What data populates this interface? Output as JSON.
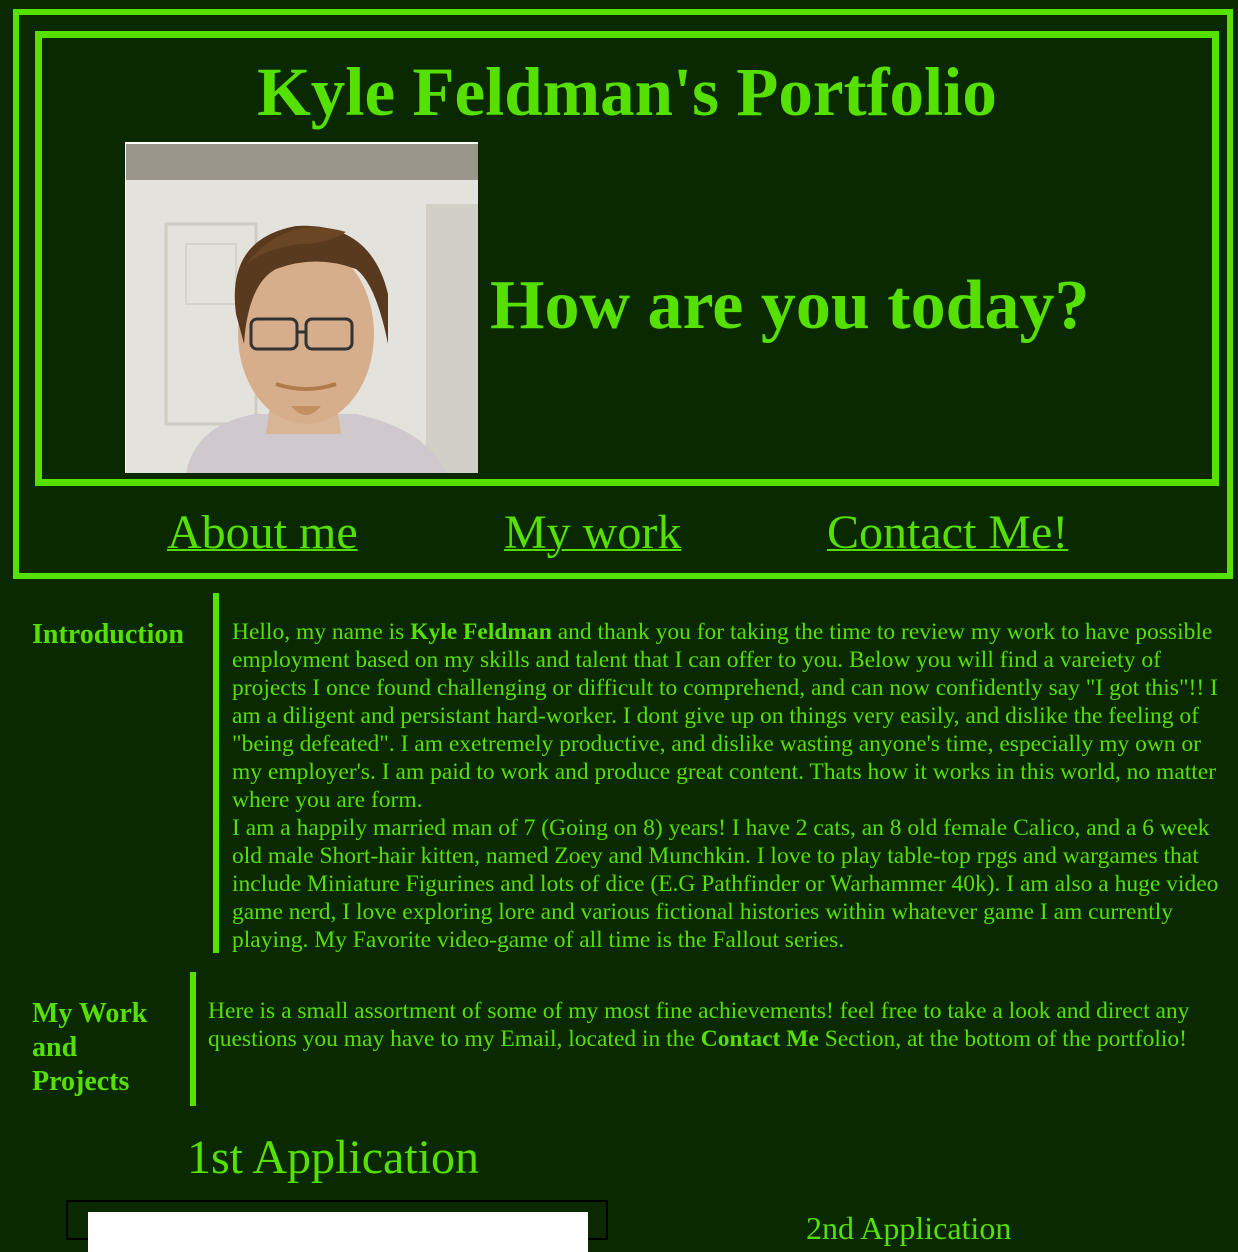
{
  "header": {
    "title": "Kyle Feldman's Portfolio",
    "greeting": "How are you today?",
    "photo_alt": "profile-photo"
  },
  "nav": {
    "items": [
      {
        "label": "About me"
      },
      {
        "label": "My work"
      },
      {
        "label": "Contact Me!"
      }
    ]
  },
  "intro": {
    "label": "Introduction",
    "p1_a": "Hello, my name is ",
    "p1_name": "Kyle Feldman",
    "p1_b": " and thank you for taking the time to review my work to have possible employment based on my skills and talent that I can offer to you. Below you will find a vareiety of projects I once found challenging or difficult to comprehend, and can now confidently say \"I got this\"!! I am a diligent and persistant hard-worker. I dont give up on things very easily, and dislike the feeling of \"being defeated\". I am exetremely productive, and dislike wasting anyone's time, especially my own or my employer's. I am paid to work and produce great content. Thats how it works in this world, no matter where you are form.",
    "p2": "I am a happily married man of 7 (Going on 8) years! I have 2 cats, an 8 old female Calico, and a 6 week old male Short-hair kitten, named Zoey and Munchkin. I love to play table-top rpgs and wargames that include Miniature Figurines and lots of dice (E.G Pathfinder or Warhammer 40k). I am also a huge video game nerd, I love exploring lore and various fictional histories within whatever game I am currently playing. My Favorite video-game of all time is the Fallout series."
  },
  "work": {
    "label_line1": "My Work",
    "label_line2": "and",
    "label_line3": "Projects",
    "text_a": "Here is a small assortment of some of my most fine achievements! feel free to take a look and direct any questions you may have to my Email, located in the ",
    "text_contact": "Contact Me",
    "text_b": "  Section, at the bottom of the portfolio!"
  },
  "apps": {
    "first_title": "1st Application",
    "second_title": "2nd Application"
  },
  "colors": {
    "background": "#0a2900",
    "accent": "#55e000"
  }
}
